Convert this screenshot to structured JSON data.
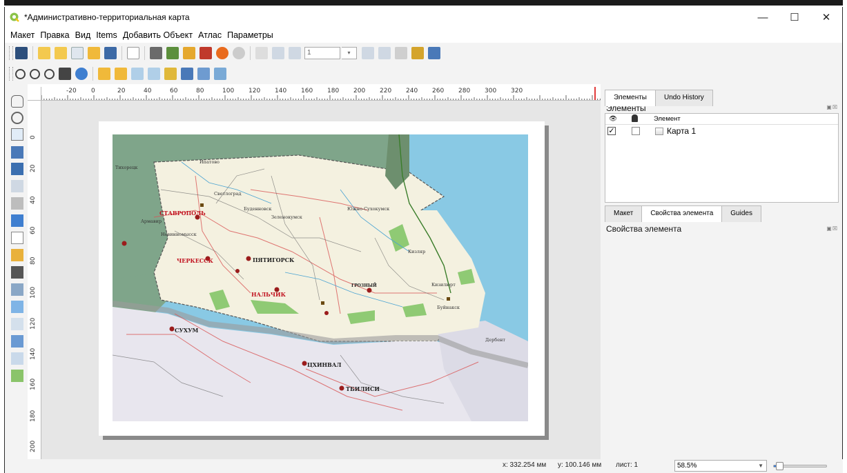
{
  "window": {
    "title": "*Административно-территориальная карта",
    "minimize": "—",
    "maximize": "☐",
    "close": "✕"
  },
  "menu": [
    "Макет",
    "Правка",
    "Вид",
    "Items",
    "Добавить Объект",
    "Атлас",
    "Параметры"
  ],
  "toolbar": {
    "atlas_page_value": "1"
  },
  "ruler": {
    "top": [
      "-20",
      "0",
      "20",
      "40",
      "60",
      "80",
      "100",
      "120",
      "140",
      "160",
      "180",
      "200",
      "220",
      "240",
      "260",
      "280",
      "300",
      "320"
    ],
    "left": [
      "0",
      "20",
      "40",
      "60",
      "80",
      "100",
      "120",
      "140",
      "160",
      "180",
      "200",
      "20"
    ]
  },
  "map": {
    "labels": [
      "СТАВРОПОЛЬ",
      "ЧЕРКЕССК",
      "ПЯТИГОРСК",
      "НАЛЬЧИК",
      "ГРОЗНЫЙ",
      "СУХУМ",
      "ЦХИНВАЛ",
      "ТБИЛИСИ",
      "Светлоград",
      "Буденновск",
      "Южно-Сухокумск",
      "Кизляр",
      "Кизилюрт",
      "Буйнакск",
      "Дербент",
      "Тихорецк",
      "Армавир",
      "Невинномысск",
      "Ипатово",
      "Зеленокумск"
    ]
  },
  "right_panel": {
    "tabs_top": [
      "Элементы",
      "Undo History"
    ],
    "items_title": "Элементы",
    "table_header": {
      "element": "Элемент"
    },
    "items": [
      {
        "name": "Карта 1",
        "visible": true,
        "locked": false
      }
    ],
    "tabs_bottom": [
      "Макет",
      "Свойства элемента",
      "Guides"
    ],
    "props_title": "Свойства элемента",
    "dock_controls": "▣☒"
  },
  "status": {
    "x": "x: 332.254 мм",
    "y": "y: 100.146 мм",
    "page": "лист: 1",
    "zoom": "58.5%",
    "zoom_slider_fraction": 0.05
  },
  "colors": {
    "accent": "#2f7d32",
    "sea": "#89c9e4",
    "land": "#f4f1e0",
    "neighbor_green": "#7fa58a",
    "georgia": "#e8e6ee",
    "capital_red": "#c1121f"
  }
}
